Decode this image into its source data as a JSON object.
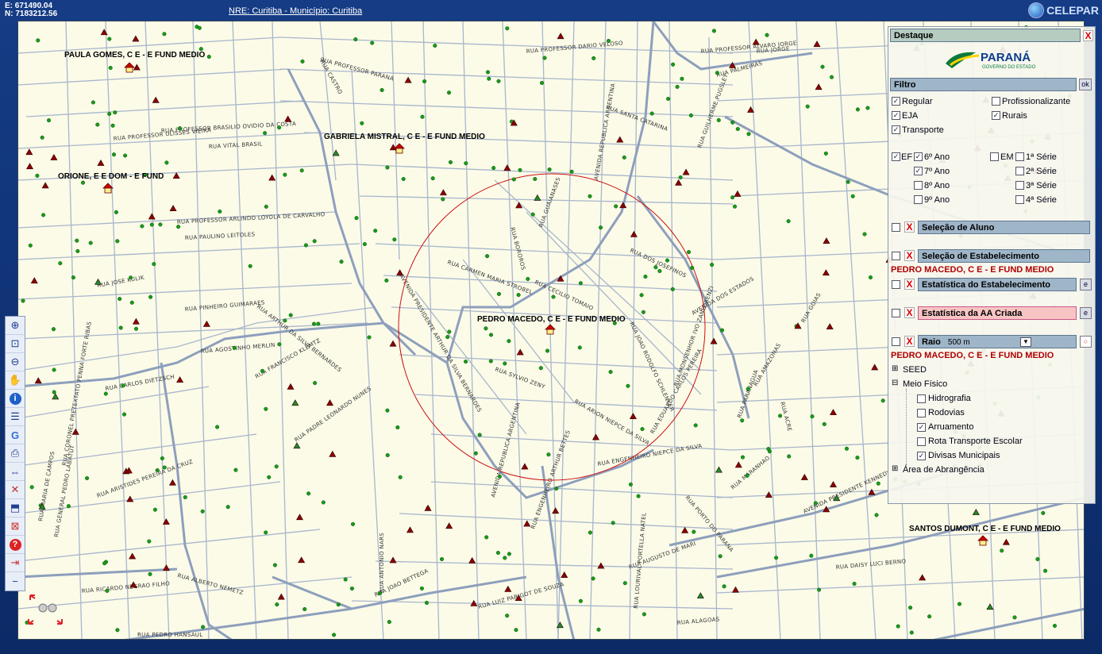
{
  "top": {
    "coord_e": "E: 671490.04",
    "coord_n": "N: 7183212.56",
    "nre": "NRE: Curitiba - Município: Curitiba",
    "logo": "CELEPAR"
  },
  "map": {
    "schools": [
      {
        "label": "PAULA GOMES, C E - E FUND MEDIO"
      },
      {
        "label": "GABRIELA MISTRAL, C E - E FUND MEDIO"
      },
      {
        "label": "ORIONE, E E DOM - E FUND"
      },
      {
        "label": "PEDRO MACEDO, C E - E FUND MEDIO"
      },
      {
        "label": "SANTOS DUMONT, C E - E FUND MEDIO"
      }
    ],
    "streets": [
      "RUA PROFESSOR ULISSES VIEIRA",
      "RUA PROFESSOR BRASILIO OVIDIO DA COSTA",
      "RUA VITAL BRASIL",
      "RUA PROFESSOR ARLINDO LOYOLA DE CARVALHO",
      "RUA PAULINO LEITOLES",
      "RUA JOSE KULIK",
      "RUA PINHEIRO GUIMARAES",
      "RUA AGOSTINHO MERLIN",
      "RUA CARLOS DIETZSCH",
      "RUA FRANCISCO KLEMTZ",
      "RUA PADRE LEONARDO NUNES",
      "RUA ARTHUR DA SILVA BERNARDES",
      "AVENIDA PRESIDENTE ARTHUR DA SILVA BERNARDES",
      "RUA CARMEN MARIA STROBEL",
      "RUA CECILIO TOMAIO",
      "RUA SYLVIO ZENY",
      "RUA ARION NIEPCE DA SILVA",
      "RUA EDUARDO CARLOS PEREIRA",
      "AVENIDA REPUBLICA ARGENTINA",
      "RUA ENGENHEIRO ARTHUR BETTES",
      "RUA ENGENHEIRO NIEPCE DA SILVA",
      "RUA JOAO RODOLFO SCHLENKER",
      "RUA DOS JOSEFINOS",
      "RUA MONSENHOR IVO ZANLORENZI",
      "AVENIDA DOS ESTADOS",
      "AVENIDA PRESIDENTE KENNEDY",
      "RUA MARANHAO",
      "RUA AUGUSTO DE MARI",
      "RUA LOURIVAL PORTELLA NATEL",
      "RUA ALAGOAS",
      "RUA DAISY LUCI BERNO",
      "RUA PEDRO HANSAUL",
      "RUA JOAO BETTEGA",
      "RUA LUIZ PARIGOT DE SOUZA",
      "RUA RICARDO NEGRAO FILHO",
      "RUA ALBERTO NEMETZ",
      "RUA ARISTIDES PEREIRA DA CRUZ",
      "RUA CORONEL PRETEXTATO PENNA FORTE RIBAS",
      "RUA GENERAL PEDRO LABATUT",
      "RUA MARIA DE CAMPOS",
      "RUA CASTRO",
      "RUA SANTA CATARINA",
      "RUA PALMEIRAS",
      "RUA JORGE",
      "RUA PROFESSOR DARIO VELOSO",
      "RUA PROFESSOR ALVARO JORGE",
      "RUA GUILHERME PUGSLEY",
      "AVENIDA REPUBLICA ARGENTINA",
      "RUA BOROROS",
      "RUA GUAIANASES",
      "RUA AMAZONAS",
      "RUA GOIAS",
      "RUA ACRE",
      "RUA PARANAGUA",
      "RUA PORTO DO PARANA",
      "RUA PROFESSOR PARANA",
      "RUA ANTONIO NARS"
    ],
    "radius_label": "500 m"
  },
  "toolbar": {
    "tools": [
      "zoom-in",
      "zoom-window",
      "zoom-out",
      "pan",
      "info",
      "legend",
      "google",
      "print",
      "measure",
      "clear",
      "area",
      "identify",
      "help",
      "exit",
      "minus"
    ]
  },
  "panel": {
    "destaque": "Destaque",
    "brand": "PARANÁ",
    "brand_sub": "GOVERNO DO ESTADO",
    "filtro": "Filtro",
    "ok": "ok",
    "regular": "Regular",
    "profissionalizante": "Profissionalizante",
    "eja": "EJA",
    "rurais": "Rurais",
    "transporte": "Transporte",
    "ef": "EF",
    "em": "EM",
    "ano6": "6º Ano",
    "ano7": "7º Ano",
    "ano8": "8º Ano",
    "ano9": "9º Ano",
    "serie1": "1ª Série",
    "serie2": "2ª Série",
    "serie3": "3ª Série",
    "serie4": "4ª Série",
    "selecao_aluno": "Seleção de Aluno",
    "selecao_estab": "Seleção de Estabelecimento",
    "estab_name": "PEDRO MACEDO, C E - E FUND MEDIO",
    "estatistica_estab": "Estatística do Estabelecimento",
    "estatistica_aa": "Estatística da AA Criada",
    "raio": "Raio",
    "raio_value": "500 m",
    "raio_estab": "PEDRO MACEDO, C E - E FUND MEDIO",
    "seed": "SEED",
    "meio_fisico": "Meio Físico",
    "hidrografia": "Hidrografia",
    "rodovias": "Rodovias",
    "arruamento": "Arruamento",
    "rota": "Rota Transporte Escolar",
    "divisas": "Divisas Municipais",
    "area_abrangencia": "Área de Abrangência"
  }
}
